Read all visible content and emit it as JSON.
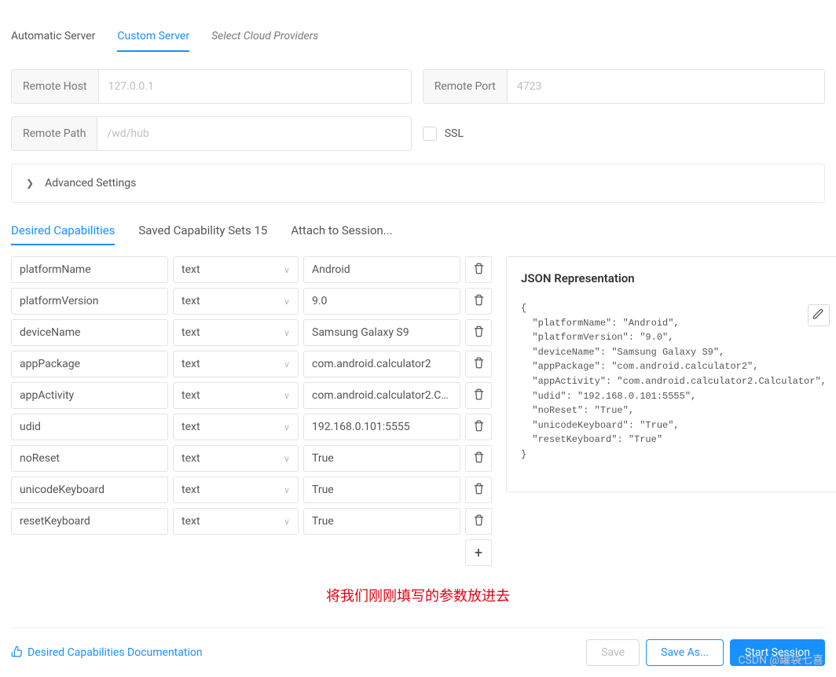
{
  "top_tabs": {
    "automatic": "Automatic Server",
    "custom": "Custom Server",
    "cloud": "Select Cloud Providers"
  },
  "host": {
    "label": "Remote Host",
    "placeholder": "127.0.0.1"
  },
  "port": {
    "label": "Remote Port",
    "placeholder": "4723"
  },
  "path": {
    "label": "Remote Path",
    "placeholder": "/wd/hub"
  },
  "ssl_label": "SSL",
  "advanced_label": "Advanced Settings",
  "mid_tabs": {
    "desired": "Desired Capabilities",
    "saved": "Saved Capability Sets 15",
    "attach": "Attach to Session..."
  },
  "caps": [
    {
      "name": "platformName",
      "type": "text",
      "value": "Android"
    },
    {
      "name": "platformVersion",
      "type": "text",
      "value": "9.0"
    },
    {
      "name": "deviceName",
      "type": "text",
      "value": "Samsung Galaxy S9"
    },
    {
      "name": "appPackage",
      "type": "text",
      "value": "com.android.calculator2"
    },
    {
      "name": "appActivity",
      "type": "text",
      "value": "com.android.calculator2.Calculator"
    },
    {
      "name": "udid",
      "type": "text",
      "value": "192.168.0.101:5555"
    },
    {
      "name": "noReset",
      "type": "text",
      "value": "True"
    },
    {
      "name": "unicodeKeyboard",
      "type": "text",
      "value": "True"
    },
    {
      "name": "resetKeyboard",
      "type": "text",
      "value": "True"
    }
  ],
  "annotation": "将我们刚刚填写的参数放进去",
  "json_title": "JSON Representation",
  "json_obj": {
    "platformName": "Android",
    "platformVersion": "9.0",
    "deviceName": "Samsung Galaxy S9",
    "appPackage": "com.android.calculator2",
    "appActivity": "com.android.calculator2.Calculator",
    "udid": "192.168.0.101:5555",
    "noReset": "True",
    "unicodeKeyboard": "True",
    "resetKeyboard": "True"
  },
  "footer": {
    "doc": "Desired Capabilities Documentation",
    "save": "Save",
    "save_as": "Save As...",
    "start": "Start Session"
  },
  "watermark": "CSDN @罐袋七喜"
}
